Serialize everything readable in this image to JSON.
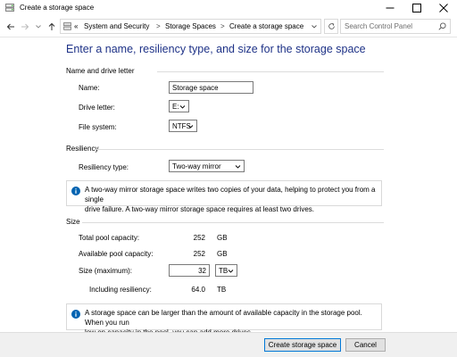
{
  "window": {
    "title": "Create a storage space"
  },
  "address": {
    "overflow": "«",
    "crumbs": [
      "System and Security",
      "Storage Spaces",
      "Create a storage space"
    ],
    "separator": ">",
    "search_placeholder": "Search Control Panel"
  },
  "page": {
    "title": "Enter a name, resiliency type, and size for the storage space"
  },
  "name_section": {
    "heading": "Name and drive letter",
    "name_label": "Name:",
    "name_value": "Storage space",
    "drive_label": "Drive letter:",
    "drive_value": "E:",
    "fs_label": "File system:",
    "fs_value": "NTFS"
  },
  "resiliency": {
    "heading": "Resiliency",
    "type_label": "Resiliency type:",
    "type_value": "Two-way mirror",
    "info_line1": "A two-way mirror storage space writes two copies of your data, helping to protect you from a single",
    "info_line2": "drive failure. A two-way mirror storage space requires at least two drives."
  },
  "size": {
    "heading": "Size",
    "total_label": "Total pool capacity:",
    "total_value": "252",
    "total_unit": "GB",
    "available_label": "Available pool capacity:",
    "available_value": "252",
    "available_unit": "GB",
    "max_label": "Size (maximum):",
    "max_value": "32",
    "max_unit": "TB",
    "including_label": "Including resiliency:",
    "including_value": "64.0",
    "including_unit": "TB",
    "info_line1": "A storage space can be larger than the amount of available capacity in the storage pool. When you run",
    "info_line2": "low on capacity in the pool, you can add more drives."
  },
  "buttons": {
    "create": "Create storage space",
    "cancel": "Cancel"
  },
  "colors": {
    "title_blue": "#1e3287",
    "info_blue": "#0063b1",
    "accent": "#0078d7"
  }
}
